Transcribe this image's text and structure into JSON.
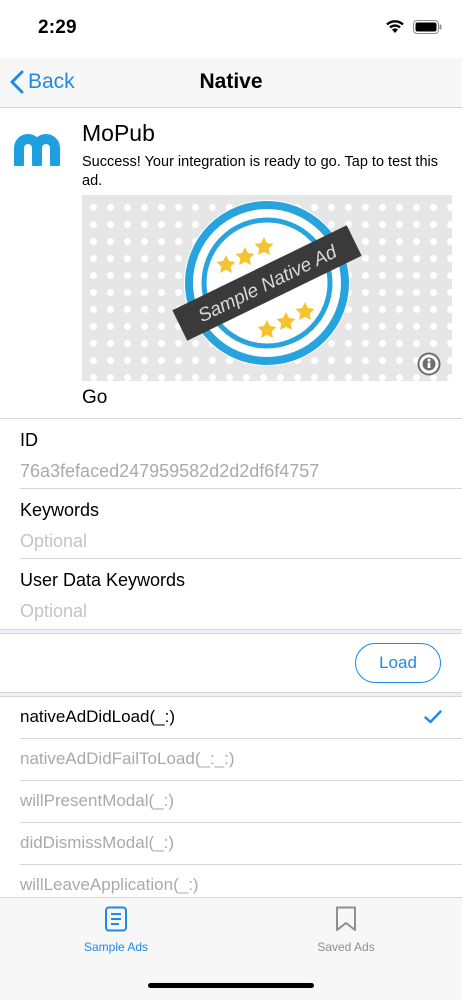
{
  "status_bar": {
    "time": "2:29"
  },
  "nav": {
    "back_label": "Back",
    "title": "Native"
  },
  "ad": {
    "title": "MoPub",
    "text": "Success! Your integration is ready to go. Tap to test this ad.",
    "image_text": "Sample Native Ad",
    "cta": "Go"
  },
  "form": {
    "id_label": "ID",
    "id_value": "76a3fefaced247959582d2d2df6f4757",
    "keywords_label": "Keywords",
    "keywords_placeholder": "Optional",
    "user_keywords_label": "User Data Keywords",
    "user_keywords_placeholder": "Optional"
  },
  "load_button": "Load",
  "callbacks": [
    {
      "label": "nativeAdDidLoad(_:)",
      "active": true
    },
    {
      "label": "nativeAdDidFailToLoad(_:_:)",
      "active": false
    },
    {
      "label": "willPresentModal(_:)",
      "active": false
    },
    {
      "label": "didDismissModal(_:)",
      "active": false
    },
    {
      "label": "willLeaveApplication(_:)",
      "active": false
    }
  ],
  "tabs": [
    {
      "label": "Sample Ads",
      "selected": true
    },
    {
      "label": "Saved Ads",
      "selected": false
    }
  ],
  "colors": {
    "accent": "#1f8ae6",
    "inactive": "#8e8e93",
    "mopub_blue": "#1ea0e0"
  }
}
